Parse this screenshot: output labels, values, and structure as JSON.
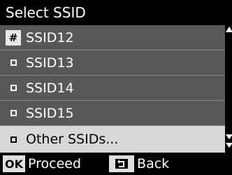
{
  "title": "Select SSID",
  "ssid_list": [
    {
      "label": "SSID12",
      "marker": "#",
      "selected": false
    },
    {
      "label": "SSID13",
      "marker": "square",
      "selected": false
    },
    {
      "label": "SSID14",
      "marker": "square",
      "selected": false
    },
    {
      "label": "SSID15",
      "marker": "square",
      "selected": false
    },
    {
      "label": "Other SSIDs...",
      "marker": "square",
      "selected": true
    }
  ],
  "footer": {
    "ok_key": "OK",
    "proceed_label": "Proceed",
    "back_label": "Back",
    "back_icon": "back-arrow-icon"
  },
  "colors": {
    "list_bg": "#585858",
    "selected_bg": "#d8d8d8",
    "key_bg": "#e0e0e0"
  }
}
